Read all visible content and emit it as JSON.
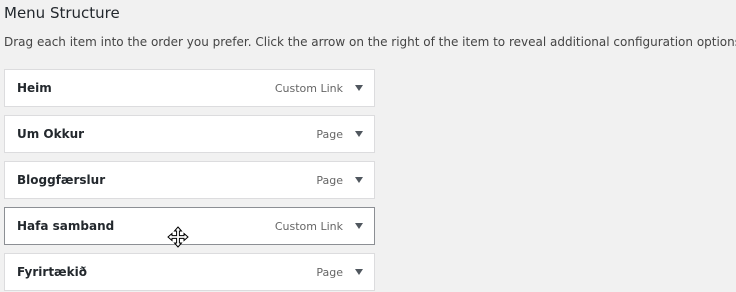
{
  "menu_structure": {
    "title": "Menu Structure",
    "instructions": "Drag each item into the order you prefer. Click the arrow on the right of the item to reveal additional configuration options."
  },
  "menu_items": [
    {
      "title": "Heim",
      "type": "Custom Link"
    },
    {
      "title": "Um Okkur",
      "type": "Page"
    },
    {
      "title": "Bloggfærslur",
      "type": "Page"
    },
    {
      "title": "Hafa samband",
      "type": "Custom Link"
    },
    {
      "title": "Fyrirtækið",
      "type": "Page"
    }
  ],
  "icons": {
    "item_toggle": "chevron-down-icon",
    "cursor": "move-cursor-icon"
  }
}
